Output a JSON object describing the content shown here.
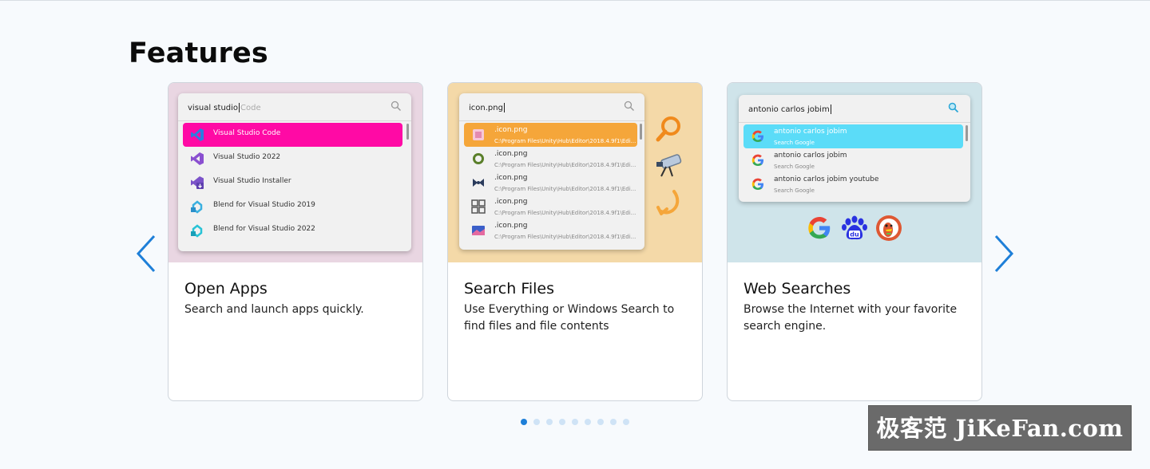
{
  "page": {
    "heading": "Features"
  },
  "nav": {
    "prev_icon": "chevron-left-icon",
    "next_icon": "chevron-right-icon",
    "accent": "#1e7fd8"
  },
  "cards": [
    {
      "title": "Open Apps",
      "description": "Search and launch apps quickly.",
      "preview": {
        "query": "visual studio",
        "query_placeholder": "Code",
        "results": [
          {
            "label": "Visual Studio Code",
            "icon": "vscode-icon",
            "selected": true
          },
          {
            "label": "Visual Studio 2022",
            "icon": "visual-studio-icon"
          },
          {
            "label": "Visual Studio Installer",
            "icon": "vs-installer-icon"
          },
          {
            "label": "Blend for Visual Studio 2019",
            "icon": "blend-icon"
          },
          {
            "label": "Blend for Visual Studio 2022",
            "icon": "blend-icon"
          }
        ],
        "highlight_color": "#ff0aa5"
      }
    },
    {
      "title": "Search Files",
      "description": "Use Everything or Windows Search to find files and file contents",
      "preview": {
        "query": "icon.png",
        "results": [
          {
            "label": ".icon.png",
            "sub": "C:\\Program Files\\Unity\\Hub\\Editor\\2018.4.9f1\\Edi...",
            "selected": true
          },
          {
            "label": ".icon.png",
            "sub": "C:\\Program Files\\Unity\\Hub\\Editor\\2018.4.9f1\\Edi..."
          },
          {
            "label": ".icon.png",
            "sub": "C:\\Program Files\\Unity\\Hub\\Editor\\2018.4.9f1\\Edi..."
          },
          {
            "label": ".icon.png",
            "sub": "C:\\Program Files\\Unity\\Hub\\Editor\\2018.4.9f1\\Edi..."
          },
          {
            "label": ".icon.png",
            "sub": "C:\\Program Files\\Unity\\Hub\\Editor\\2018.4.9f1\\Edi..."
          }
        ],
        "highlight_color": "#f5a63a",
        "side_icons": [
          "magnifier-icon",
          "telescope-icon",
          "refresh-arrow-icon"
        ]
      }
    },
    {
      "title": "Web Searches",
      "description": "Browse the Internet with your favorite search engine.",
      "preview": {
        "query": "antonio carlos jobim",
        "results": [
          {
            "label": "antonio carlos jobim",
            "sub": "Search Google",
            "selected": true
          },
          {
            "label": "antonio carlos jobim",
            "sub": "Search Google"
          },
          {
            "label": "antonio carlos jobim youtube",
            "sub": "Search Google"
          }
        ],
        "highlight_color": "#5bdcf8",
        "engines": [
          "google-icon",
          "baidu-icon",
          "duckduckgo-icon"
        ]
      }
    }
  ],
  "pagination": {
    "count": 9,
    "active_index": 0
  },
  "watermark": {
    "text": "极客范 JiKeFan.com"
  }
}
